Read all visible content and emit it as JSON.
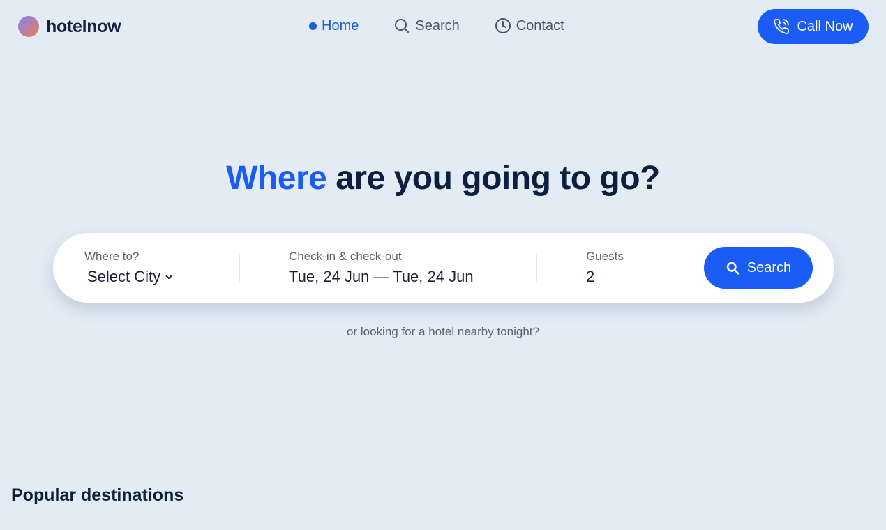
{
  "brand": {
    "name": "hotelnow"
  },
  "nav": {
    "items": [
      {
        "label": "Home",
        "icon": "dot-indicator",
        "active": true
      },
      {
        "label": "Search",
        "icon": "search-icon"
      },
      {
        "label": "Contact",
        "icon": "clock-icon"
      }
    ]
  },
  "header": {
    "call_label": "Call Now",
    "call_icon": "phone-icon"
  },
  "hero": {
    "title_accent": "Where",
    "title_rest": " are you going to go?"
  },
  "search": {
    "city": {
      "label": "Where to?",
      "value": "Select City"
    },
    "dates": {
      "label": "Check-in & check-out",
      "value": "Tue, 24 Jun — Tue, 24 Jun"
    },
    "guests": {
      "label": "Guests",
      "value": "2"
    },
    "button_label": "Search"
  },
  "nearby_text": "or looking for a hotel nearby tonight?",
  "popular_title": "Popular destinations",
  "colors": {
    "accent": "#1a5cf5",
    "background": "#e3ecf5",
    "dark_text": "#0c1f3f"
  }
}
